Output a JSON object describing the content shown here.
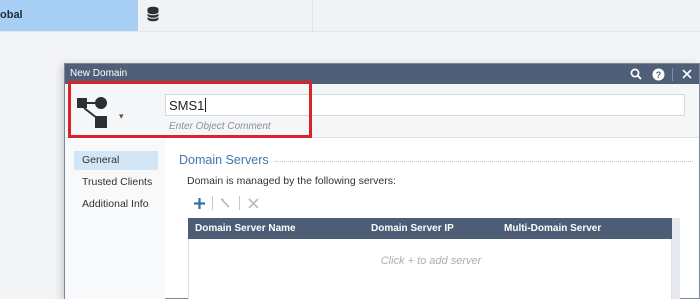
{
  "app": {
    "global_tab_label": "obal",
    "database_tab_icon": "database-icon"
  },
  "dialog": {
    "title": "New Domain",
    "title_icons": [
      "search-icon",
      "help-icon",
      "close-icon"
    ],
    "object_icon": "domain-topology-icon",
    "name_value": "SMS1",
    "comment_placeholder": "Enter Object Comment"
  },
  "sidenav": {
    "items": [
      {
        "label": "General",
        "active": true
      },
      {
        "label": "Trusted Clients",
        "active": false
      },
      {
        "label": "Additional Info",
        "active": false
      }
    ]
  },
  "section": {
    "title": "Domain Servers",
    "description": "Domain is managed by the following servers:",
    "toolbar": [
      "add-icon",
      "edit-icon",
      "delete-icon"
    ]
  },
  "grid": {
    "columns": [
      "Domain Server Name",
      "Domain Server IP",
      "Multi-Domain Server"
    ],
    "empty_message": "Click + to add server"
  },
  "colors": {
    "titlebar": "#4f5f78",
    "accent": "#3e78ad",
    "highlight": "#d8232a",
    "selected_nav": "#d3e6f5"
  }
}
